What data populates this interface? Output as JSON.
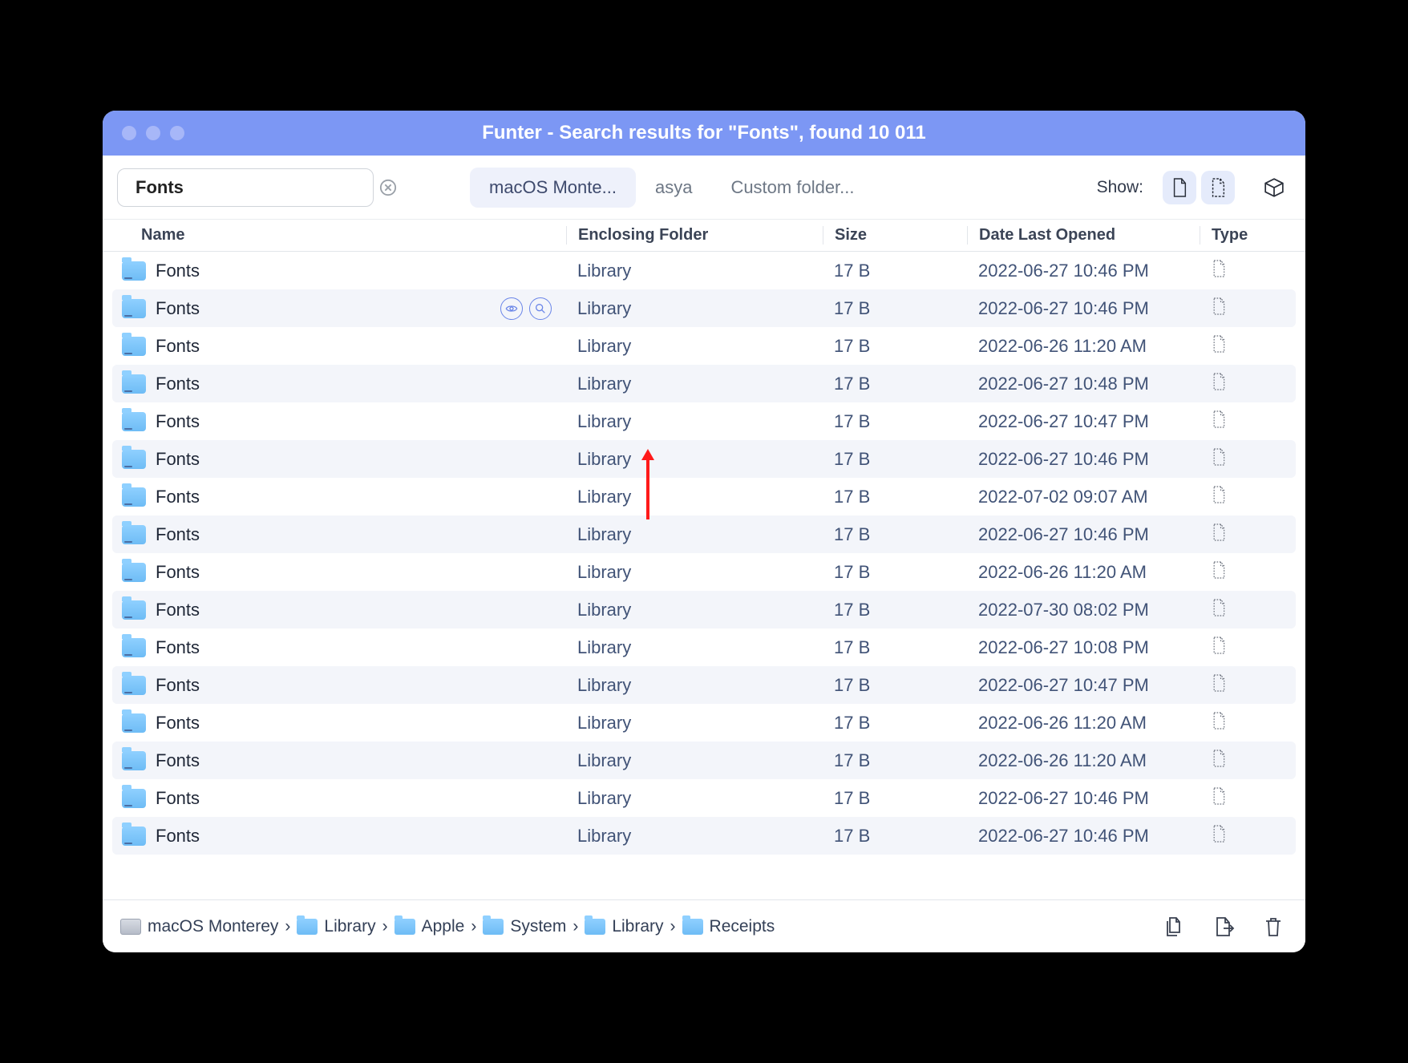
{
  "window": {
    "title": "Funter - Search results for \"Fonts\", found 10 011"
  },
  "toolbar": {
    "search_value": "Fonts",
    "scopes": [
      {
        "label": "macOS Monte...",
        "active": true
      },
      {
        "label": "asya",
        "active": false
      },
      {
        "label": "Custom folder...",
        "active": false
      }
    ],
    "show_label": "Show:",
    "show_files_active": true,
    "show_hidden_active": true
  },
  "columns": {
    "name": "Name",
    "folder": "Enclosing Folder",
    "size": "Size",
    "date": "Date Last Opened",
    "type": "Type"
  },
  "rows": [
    {
      "name": "Fonts",
      "folder": "Library",
      "size": "17 B",
      "date": "2022-06-27 10:46 PM",
      "hover": false
    },
    {
      "name": "Fonts",
      "folder": "Library",
      "size": "17 B",
      "date": "2022-06-27 10:46 PM",
      "hover": true
    },
    {
      "name": "Fonts",
      "folder": "Library",
      "size": "17 B",
      "date": "2022-06-26 11:20 AM",
      "hover": false
    },
    {
      "name": "Fonts",
      "folder": "Library",
      "size": "17 B",
      "date": "2022-06-27 10:48 PM",
      "hover": false
    },
    {
      "name": "Fonts",
      "folder": "Library",
      "size": "17 B",
      "date": "2022-06-27 10:47 PM",
      "hover": false
    },
    {
      "name": "Fonts",
      "folder": "Library",
      "size": "17 B",
      "date": "2022-06-27 10:46 PM",
      "hover": false
    },
    {
      "name": "Fonts",
      "folder": "Library",
      "size": "17 B",
      "date": "2022-07-02 09:07 AM",
      "hover": false
    },
    {
      "name": "Fonts",
      "folder": "Library",
      "size": "17 B",
      "date": "2022-06-27 10:46 PM",
      "hover": false
    },
    {
      "name": "Fonts",
      "folder": "Library",
      "size": "17 B",
      "date": "2022-06-26 11:20 AM",
      "hover": false
    },
    {
      "name": "Fonts",
      "folder": "Library",
      "size": "17 B",
      "date": "2022-07-30 08:02 PM",
      "hover": false
    },
    {
      "name": "Fonts",
      "folder": "Library",
      "size": "17 B",
      "date": "2022-06-27 10:08 PM",
      "hover": false
    },
    {
      "name": "Fonts",
      "folder": "Library",
      "size": "17 B",
      "date": "2022-06-27 10:47 PM",
      "hover": false
    },
    {
      "name": "Fonts",
      "folder": "Library",
      "size": "17 B",
      "date": "2022-06-26 11:20 AM",
      "hover": false
    },
    {
      "name": "Fonts",
      "folder": "Library",
      "size": "17 B",
      "date": "2022-06-26 11:20 AM",
      "hover": false
    },
    {
      "name": "Fonts",
      "folder": "Library",
      "size": "17 B",
      "date": "2022-06-27 10:46 PM",
      "hover": false
    },
    {
      "name": "Fonts",
      "folder": "Library",
      "size": "17 B",
      "date": "2022-06-27 10:46 PM",
      "hover": false
    }
  ],
  "breadcrumbs": [
    {
      "label": "macOS Monterey",
      "icon": "disk"
    },
    {
      "label": "Library",
      "icon": "folder"
    },
    {
      "label": "Apple",
      "icon": "folder"
    },
    {
      "label": "System",
      "icon": "folder"
    },
    {
      "label": "Library",
      "icon": "folder"
    },
    {
      "label": "Receipts",
      "icon": "folder"
    }
  ]
}
